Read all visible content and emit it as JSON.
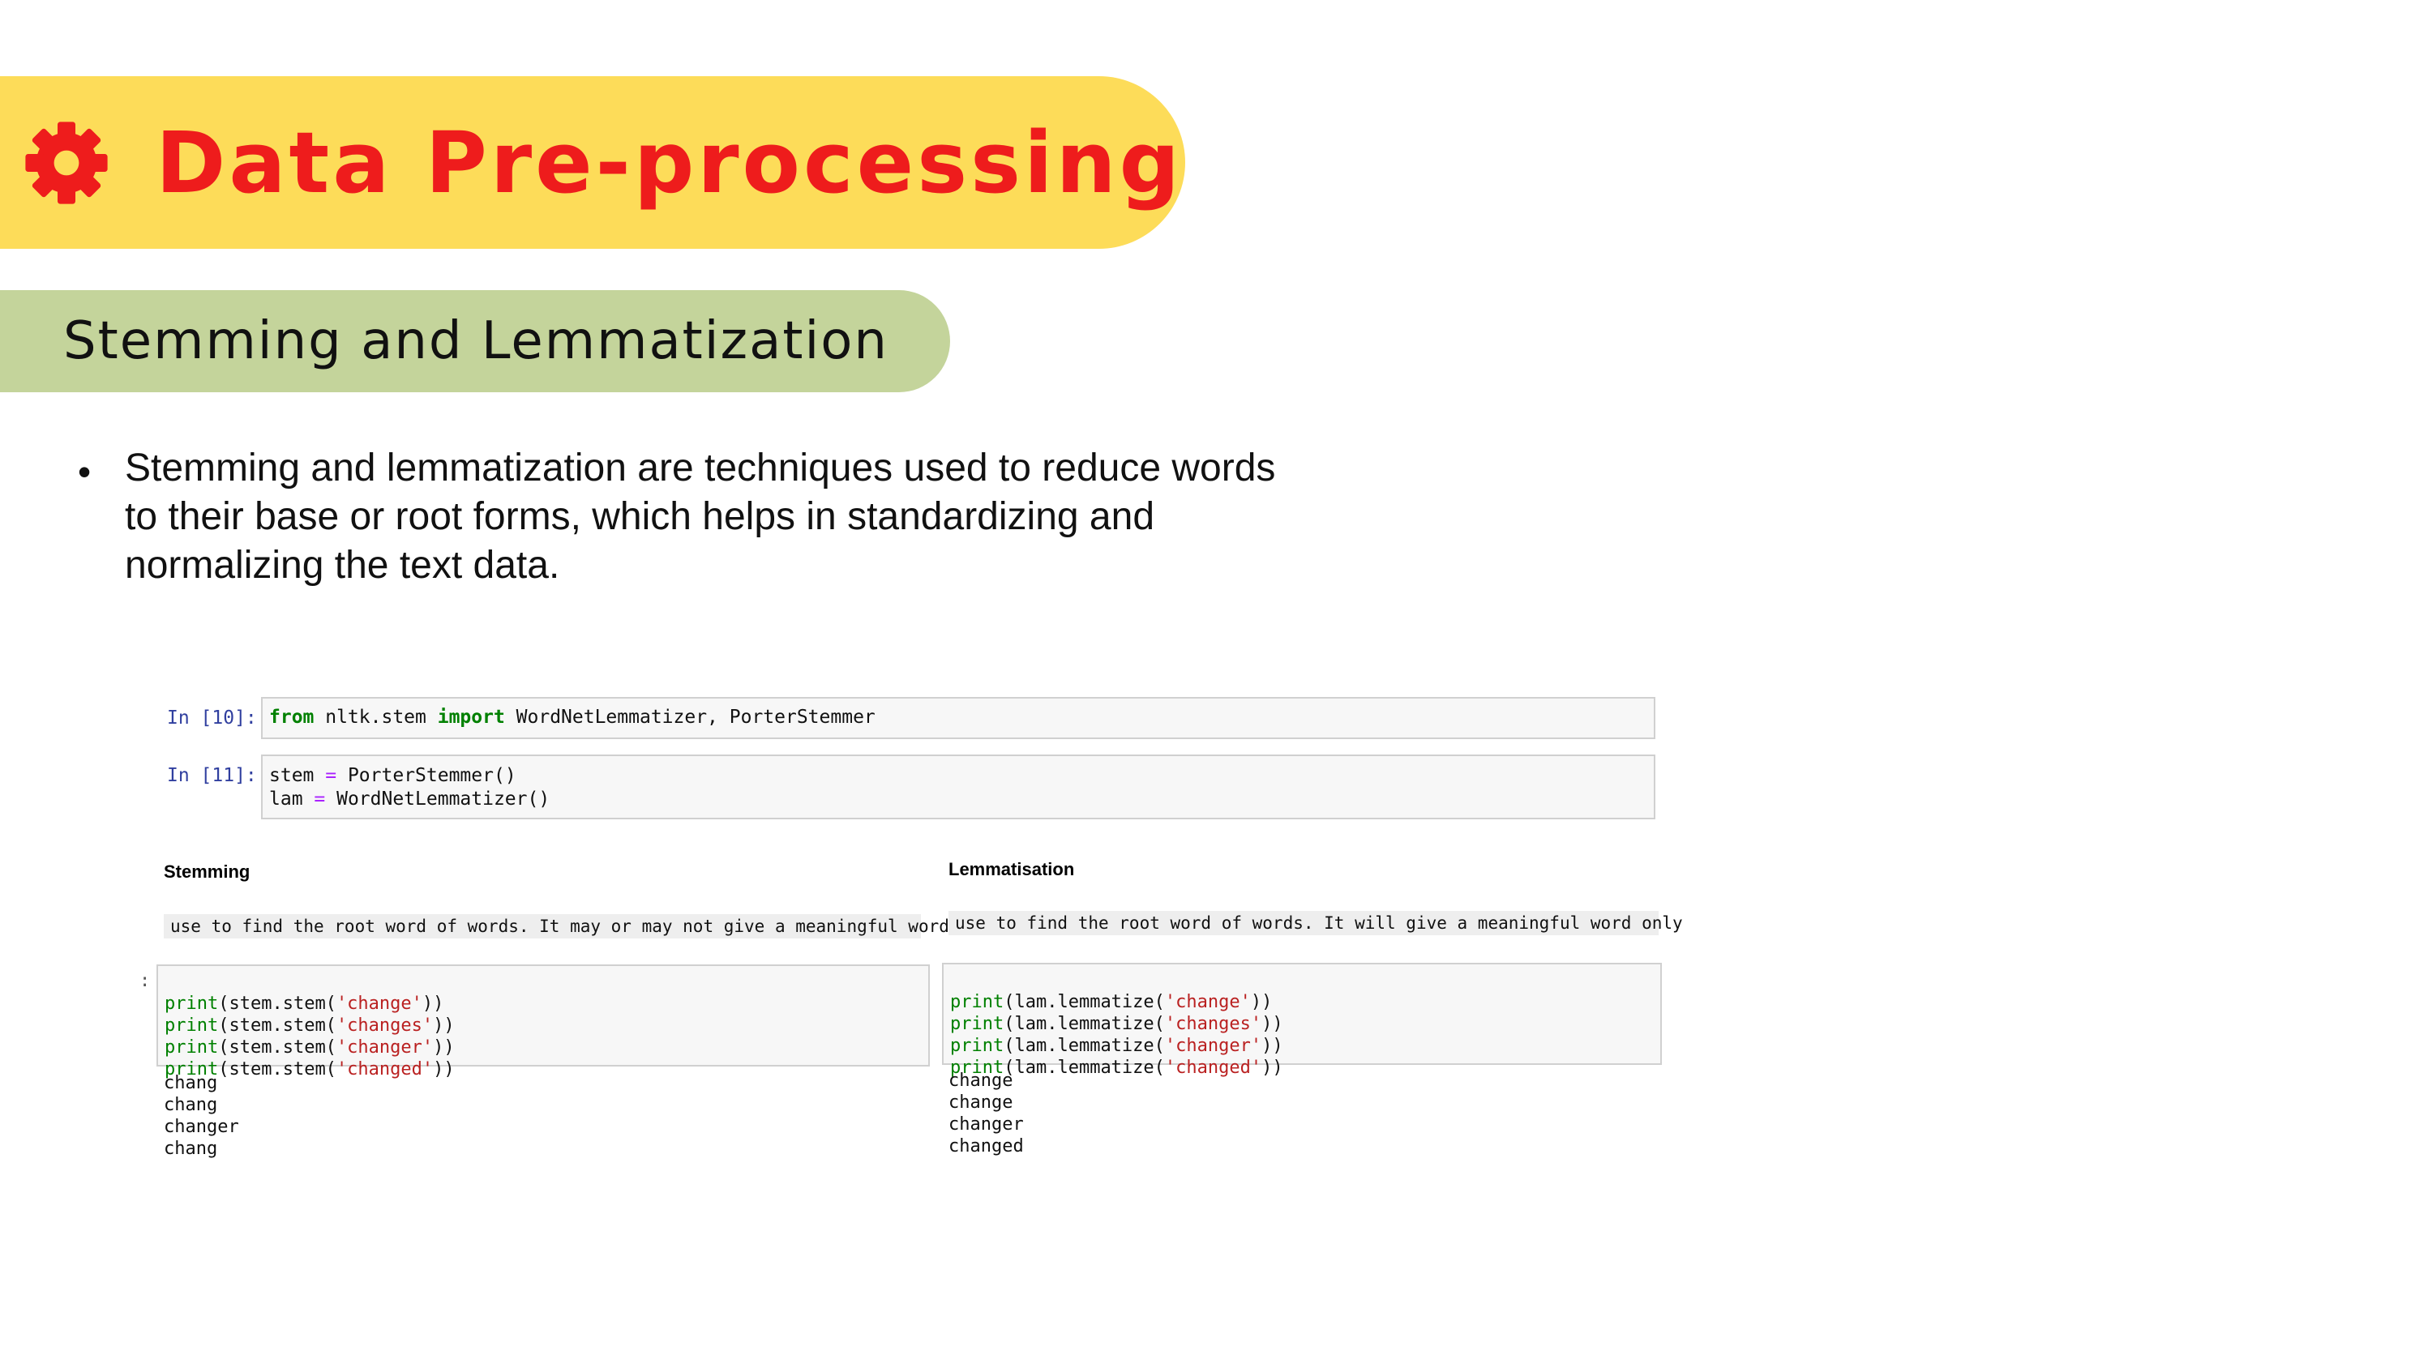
{
  "slide": {
    "title": "Data Pre-processing",
    "subtitle": "Stemming and Lemmatization",
    "bullet": "Stemming and lemmatization are techniques used to reduce words to their base or root forms, which helps in standardizing and normalizing the text data.",
    "colors": {
      "title": "#ee1c1c",
      "title_banner": "#fddc59",
      "sub_banner": "#c4d49b"
    },
    "icon": "gear-icon"
  },
  "notebook": {
    "cell1": {
      "prompt": "In [10]:",
      "kw_from": "from",
      "module": " nltk.stem ",
      "kw_import": "import",
      "names": " WordNetLemmatizer, PorterStemmer"
    },
    "cell2": {
      "prompt": "In [11]:",
      "line1_var": "stem ",
      "line1_op": "=",
      "line1_rest": " PorterStemmer()",
      "line2_var": "lam ",
      "line2_op": "=",
      "line2_rest": " WordNetLemmatizer()"
    },
    "stemming": {
      "heading": "Stemming",
      "description": "use to find the root word of words. It may or may not give a meaningful word",
      "prompt_colon": ":",
      "code": [
        {
          "fn": "print",
          "mid": "(stem.stem(",
          "arg": "'change'",
          "end": "))"
        },
        {
          "fn": "print",
          "mid": "(stem.stem(",
          "arg": "'changes'",
          "end": "))"
        },
        {
          "fn": "print",
          "mid": "(stem.stem(",
          "arg": "'changer'",
          "end": "))"
        },
        {
          "fn": "print",
          "mid": "(stem.stem(",
          "arg": "'changed'",
          "end": "))"
        }
      ],
      "output": [
        "chang",
        "chang",
        "changer",
        "chang"
      ]
    },
    "lemmatisation": {
      "heading": "Lemmatisation",
      "description": "use to find the root word of words. It will give a meaningful word only",
      "code": [
        {
          "fn": "print",
          "mid": "(lam.lemmatize(",
          "arg": "'change'",
          "end": "))"
        },
        {
          "fn": "print",
          "mid": "(lam.lemmatize(",
          "arg": "'changes'",
          "end": "))"
        },
        {
          "fn": "print",
          "mid": "(lam.lemmatize(",
          "arg": "'changer'",
          "end": "))"
        },
        {
          "fn": "print",
          "mid": "(lam.lemmatize(",
          "arg": "'changed'",
          "end": "))"
        }
      ],
      "output": [
        "change",
        "change",
        "changer",
        "changed"
      ]
    }
  }
}
